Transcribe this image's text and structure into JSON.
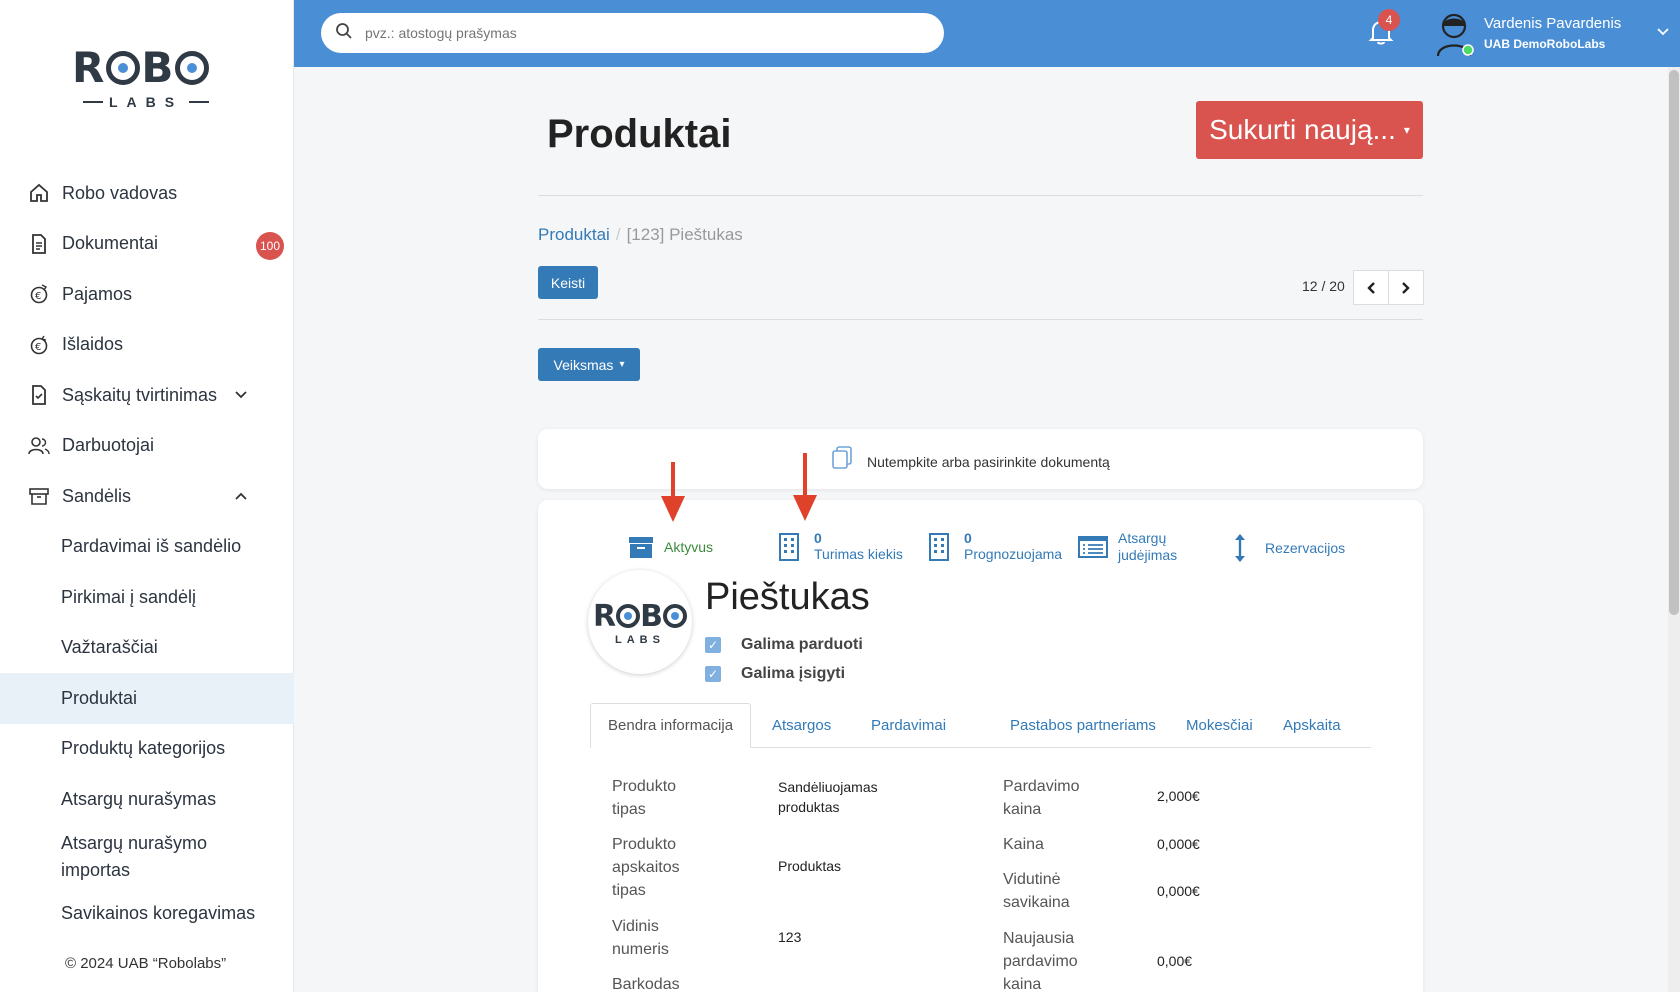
{
  "search": {
    "placeholder": "pvz.: atostogų prašymas"
  },
  "topbar": {
    "notifications_count": "4",
    "user_name": "Vardenis Pavardenis",
    "user_company": "UAB DemoRoboLabs"
  },
  "logo": {
    "main_r": "R",
    "main_b": "B",
    "sub": "LABS"
  },
  "sidebar": {
    "items": [
      {
        "label": "Robo vadovas",
        "icon": "home-icon"
      },
      {
        "label": "Dokumentai",
        "icon": "document-icon",
        "badge": "100"
      },
      {
        "label": "Pajamos",
        "icon": "income-icon"
      },
      {
        "label": "Išlaidos",
        "icon": "expense-icon"
      },
      {
        "label": "Sąskaitų tvirtinimas",
        "icon": "invoice-approve-icon"
      },
      {
        "label": "Darbuotojai",
        "icon": "employees-icon"
      },
      {
        "label": "Sandėlis",
        "icon": "warehouse-icon"
      }
    ],
    "subitems": [
      "Pardavimai iš sandėlio",
      "Pirkimai į sandėlį",
      "Važtaraščiai",
      "Produktai",
      "Produktų kategorijos",
      "Atsargų nurašymas",
      "Atsargų nurašymo importas",
      "Savikainos koregavimas"
    ],
    "copyright": "© 2024 UAB “Robolabs”"
  },
  "main": {
    "title": "Produktai",
    "create_button": "Sukurti naują...",
    "breadcrumb_link": "Produktai",
    "breadcrumb_current": "[123] Pieštukas",
    "edit_button": "Keisti",
    "pager": "12 / 20",
    "action_button": "Veiksmas",
    "dropzone_text": "Nutempkite arba pasirinkite dokumentą"
  },
  "product": {
    "stats": {
      "active": "Aktyvus",
      "stock_num": "0",
      "stock_label": "Turimas kiekis",
      "forecast_num": "0",
      "forecast_label": "Prognozuojama",
      "movement_label_1": "Atsargų",
      "movement_label_2": "judėjimas",
      "reservations": "Rezervacijos"
    },
    "logo_text": "ROBO",
    "logo_sub": "LABS",
    "name": "Pieštukas",
    "can_sell": "Galima parduoti",
    "can_buy": "Galima įsigyti",
    "tabs": [
      "Bendra informacija",
      "Atsargos",
      "Pardavimai",
      "Pastabos partneriams",
      "Mokesčiai",
      "Apskaita"
    ],
    "fields_left": [
      {
        "label_1": "Produkto",
        "label_2": "tipas",
        "value_1": "Sandėliuojamas",
        "value_2": "produktas"
      },
      {
        "label_1": "Produkto",
        "label_2": "apskaitos",
        "label_3": "tipas",
        "value_1": "Produktas"
      },
      {
        "label_1": "Vidinis",
        "label_2": "numeris",
        "value_1": "123"
      },
      {
        "label_1": "Barkodas"
      }
    ],
    "fields_right": [
      {
        "label_1": "Pardavimo",
        "label_2": "kaina",
        "value_1": "2,000€"
      },
      {
        "label_1": "Kaina",
        "value_1": "0,000€"
      },
      {
        "label_1": "Vidutinė",
        "label_2": "savikaina",
        "value_1": "0,000€"
      },
      {
        "label_1": "Naujausia",
        "label_2": "pardavimo",
        "label_3": "kaina",
        "value_1": "0,00€"
      }
    ]
  },
  "colors": {
    "topbar": "#4a8fd6",
    "primary": "#337ab7",
    "danger": "#d9534f",
    "arrow": "#e0412a"
  }
}
